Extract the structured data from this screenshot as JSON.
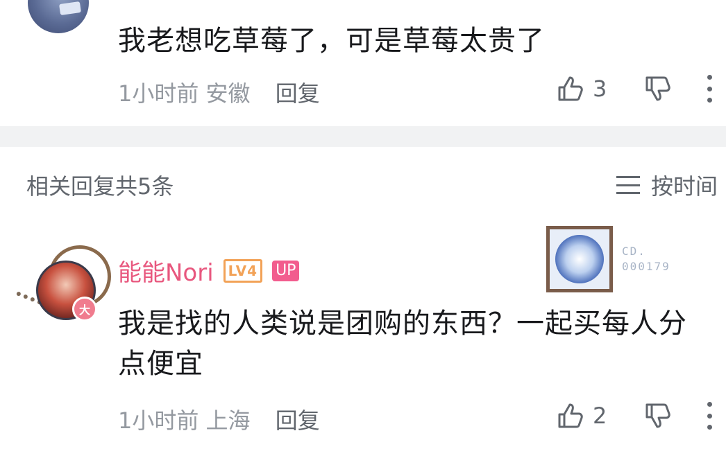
{
  "top_comment": {
    "text": "我老想吃草莓了，可是草莓太贵了",
    "time": "1小时前",
    "location": "安徽",
    "reply_label": "回复",
    "like_count": "3"
  },
  "replies_header": {
    "title": "相关回复共5条",
    "sort_label": "按时间"
  },
  "reply_comment": {
    "username": "能能Nori",
    "level_badge": "LV4",
    "up_badge": "UP",
    "avatar_badge": "大",
    "decoration_label_line1": "CD.",
    "decoration_label_line2": "000179",
    "text": "我是找的人类说是团购的东西？一起买每人分点便宜",
    "time": "1小时前",
    "location": "上海",
    "reply_label": "回复",
    "like_count": "2"
  },
  "colors": {
    "username": "#e8577e",
    "level": "#f2a257",
    "up_badge": "#f25d8e",
    "divider": "#f1f2f3",
    "meta_text": "#9499a0"
  }
}
